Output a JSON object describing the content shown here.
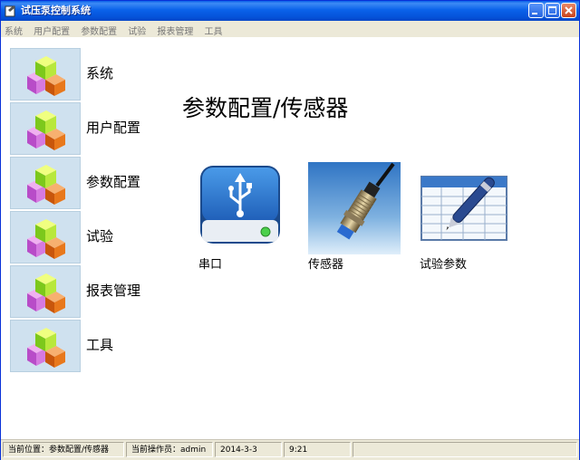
{
  "window": {
    "title": "试压泵控制系统"
  },
  "menu": [
    "系统",
    "用户配置",
    "参数配置",
    "试验",
    "报表管理",
    "工具"
  ],
  "nav": [
    {
      "label": "系统",
      "icon": "cubes-icon"
    },
    {
      "label": "用户配置",
      "icon": "cubes-icon"
    },
    {
      "label": "参数配置",
      "icon": "cubes-icon"
    },
    {
      "label": "试验",
      "icon": "cubes-icon"
    },
    {
      "label": "报表管理",
      "icon": "cubes-icon"
    },
    {
      "label": "工具",
      "icon": "cubes-icon"
    }
  ],
  "page": {
    "heading": "参数配置/传感器"
  },
  "tiles": [
    {
      "label": "串口",
      "icon": "usb-icon"
    },
    {
      "label": "传感器",
      "icon": "sensor-icon"
    },
    {
      "label": "试验参数",
      "icon": "spreadsheet-pen-icon"
    }
  ],
  "status": {
    "location_label": "当前位置：",
    "location": "参数配置/传感器",
    "operator_label": "当前操作员：",
    "operator": "admin",
    "date": "2014-3-3",
    "time": "9:21"
  }
}
